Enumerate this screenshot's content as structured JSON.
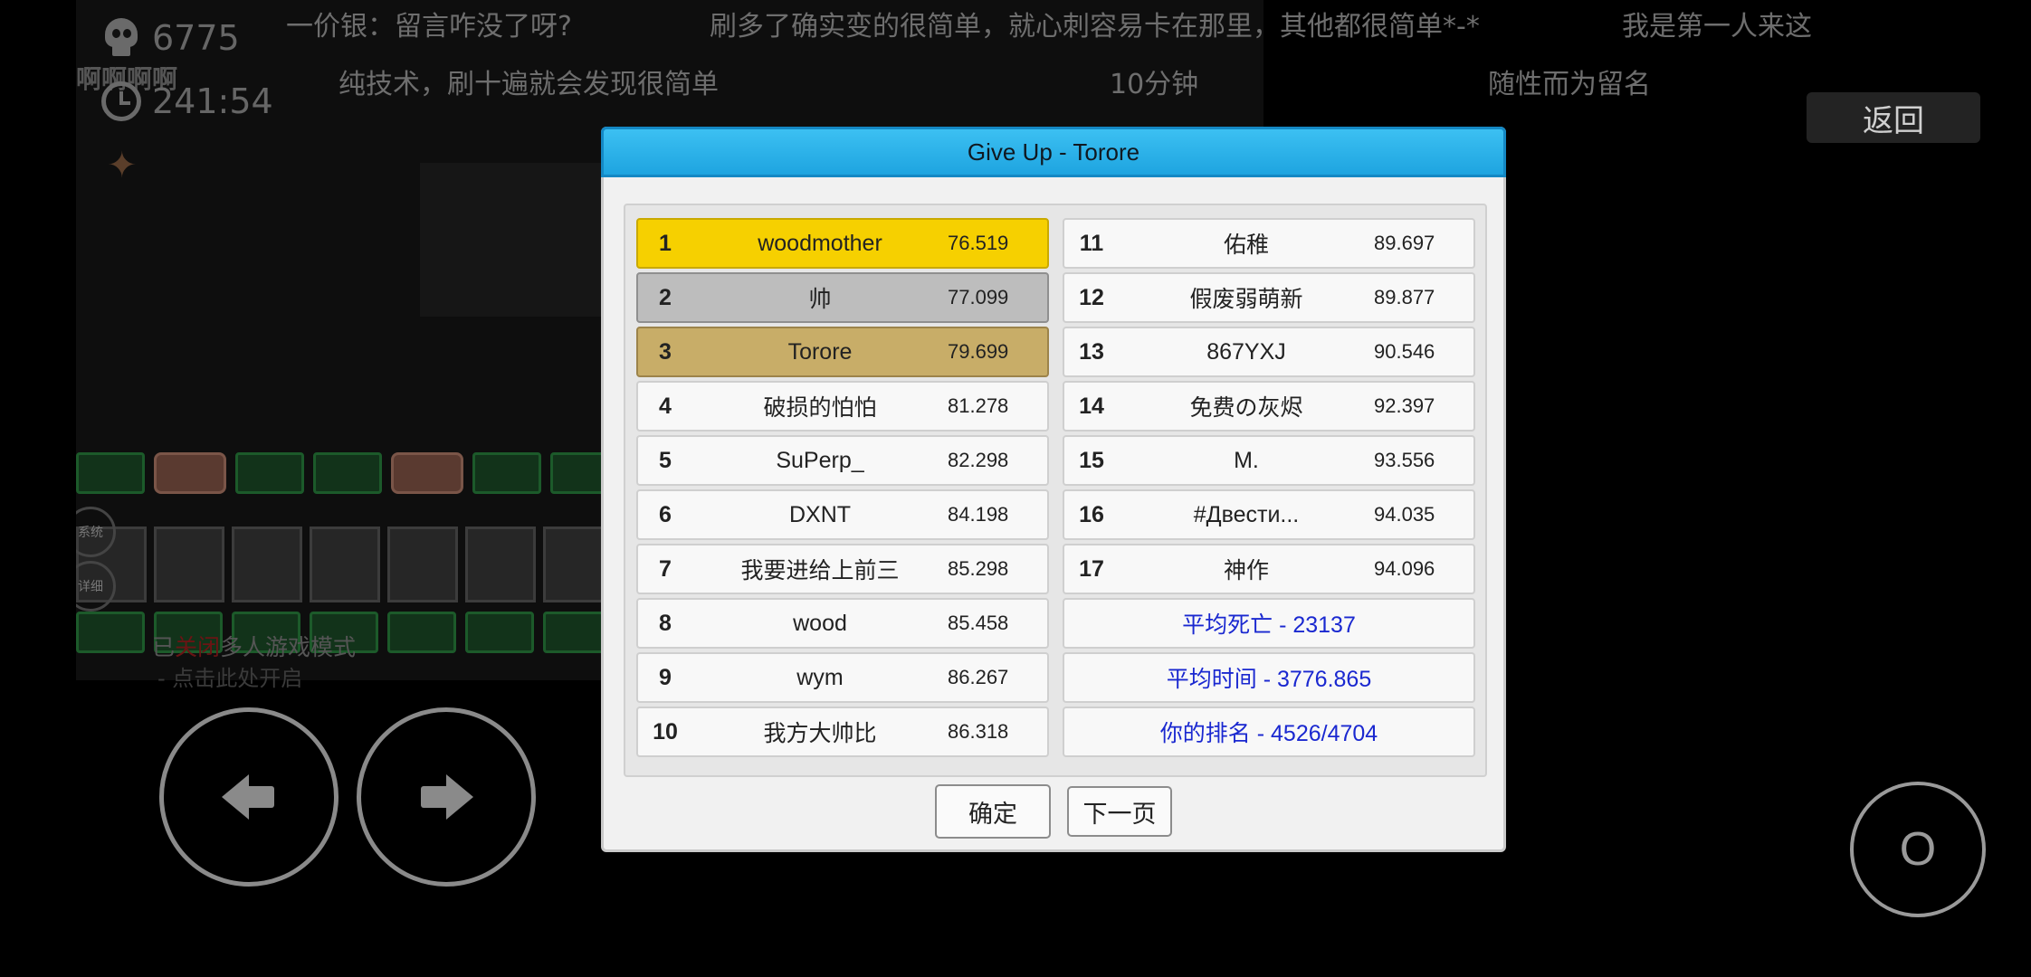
{
  "hud": {
    "deaths": "6775",
    "time": "241:54",
    "player": "啊啊啊啊"
  },
  "comments": [
    "一价银：留言咋没了呀?",
    "刷多了确实变的很简单，就心刺容易卡在那里，其他都很简单*-*",
    "我是第一人来这",
    "纯技术，刷十遍就会发现很简单",
    "10分钟",
    "随性而为留名"
  ],
  "back_button": "返回",
  "multiplayer": {
    "prefix": "已",
    "state": "关闭",
    "suffix": "多人游戏模式",
    "hint": "- 点击此处开启"
  },
  "side_buttons": [
    "系统",
    "详细"
  ],
  "dialog": {
    "title": "Give Up - Torore",
    "leaderboard_left": [
      {
        "rank": "1",
        "name": "woodmother",
        "time": "76.519"
      },
      {
        "rank": "2",
        "name": "帅",
        "time": "77.099"
      },
      {
        "rank": "3",
        "name": "Torore",
        "time": "79.699"
      },
      {
        "rank": "4",
        "name": "破损的怕怕",
        "time": "81.278"
      },
      {
        "rank": "5",
        "name": "SuPerp_",
        "time": "82.298"
      },
      {
        "rank": "6",
        "name": "DXNT",
        "time": "84.198"
      },
      {
        "rank": "7",
        "name": "我要进给上前三",
        "time": "85.298"
      },
      {
        "rank": "8",
        "name": "wood",
        "time": "85.458"
      },
      {
        "rank": "9",
        "name": "wym",
        "time": "86.267"
      },
      {
        "rank": "10",
        "name": "我方大帅比",
        "time": "86.318"
      }
    ],
    "leaderboard_right": [
      {
        "rank": "11",
        "name": "佑稚",
        "time": "89.697"
      },
      {
        "rank": "12",
        "name": "假废弱萌新",
        "time": "89.877"
      },
      {
        "rank": "13",
        "name": "867YXJ",
        "time": "90.546"
      },
      {
        "rank": "14",
        "name": "免费の灰烬",
        "time": "92.397"
      },
      {
        "rank": "15",
        "name": "M.",
        "time": "93.556"
      },
      {
        "rank": "16",
        "name": "#Двести...",
        "time": "94.035"
      },
      {
        "rank": "17",
        "name": "神作",
        "time": "94.096"
      }
    ],
    "stats": {
      "avg_deaths": "平均死亡 - 23137",
      "avg_time": "平均时间 - 3776.865",
      "your_rank": "你的排名 - 4526/4704"
    },
    "ok_label": "确定",
    "next_label": "下一页"
  },
  "controls": {
    "jump_label": "O"
  },
  "colors": {
    "gold": "#f6d000",
    "silver": "#bdbdbd",
    "bronze": "#c8ad68",
    "titlebar": "#1ea4e0",
    "stat_text": "#1a28d0"
  }
}
